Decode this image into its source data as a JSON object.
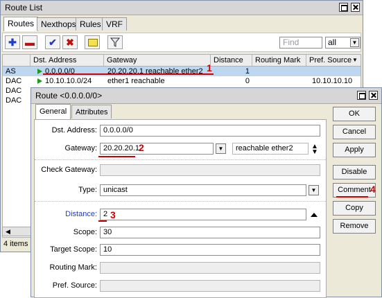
{
  "route_list": {
    "title": "Route List",
    "tabs": [
      "Routes",
      "Nexthops",
      "Rules",
      "VRF"
    ],
    "find_placeholder": "Find",
    "filter_value": "all",
    "columns": [
      "Dst. Address",
      "Gateway",
      "Distance",
      "Routing Mark",
      "Pref. Source"
    ],
    "rows": [
      {
        "flags": "AS",
        "dst": "0.0.0.0/0",
        "gateway": "20.20.20.1 reachable ether2",
        "distance": "1",
        "mark": "",
        "pref": ""
      },
      {
        "flags": "DAC",
        "dst": "10.10.10.0/24",
        "gateway": "ether1 reachable",
        "distance": "0",
        "mark": "",
        "pref": "10.10.10.10"
      },
      {
        "flags": "DAC",
        "dst": "",
        "gateway": "",
        "distance": "",
        "mark": "",
        "pref": ""
      },
      {
        "flags": "DAC",
        "dst": "",
        "gateway": "",
        "distance": "",
        "mark": "",
        "pref": ""
      }
    ],
    "status": "4 items"
  },
  "route_dialog": {
    "title": "Route <0.0.0.0/0>",
    "tabs": [
      "General",
      "Attributes"
    ],
    "labels": {
      "dst": "Dst. Address:",
      "gateway": "Gateway:",
      "check_gateway": "Check Gateway:",
      "type": "Type:",
      "distance": "Distance:",
      "scope": "Scope:",
      "target_scope": "Target Scope:",
      "routing_mark": "Routing Mark:",
      "pref_source": "Pref. Source:"
    },
    "values": {
      "dst": "0.0.0.0/0",
      "gateway": "20.20.20.1",
      "gateway_state": "reachable ether2",
      "check_gateway": "",
      "type": "unicast",
      "distance": "2",
      "scope": "30",
      "target_scope": "10",
      "routing_mark": "",
      "pref_source": ""
    },
    "buttons": [
      "OK",
      "Cancel",
      "Apply",
      "Disable",
      "Comment",
      "Copy",
      "Remove"
    ]
  },
  "annotations": [
    "1",
    "2",
    "3",
    "4"
  ],
  "colors": {
    "annotation": "#d00000",
    "selected_row": "#bdd7f0",
    "distance_label": "#1f3fbf"
  }
}
